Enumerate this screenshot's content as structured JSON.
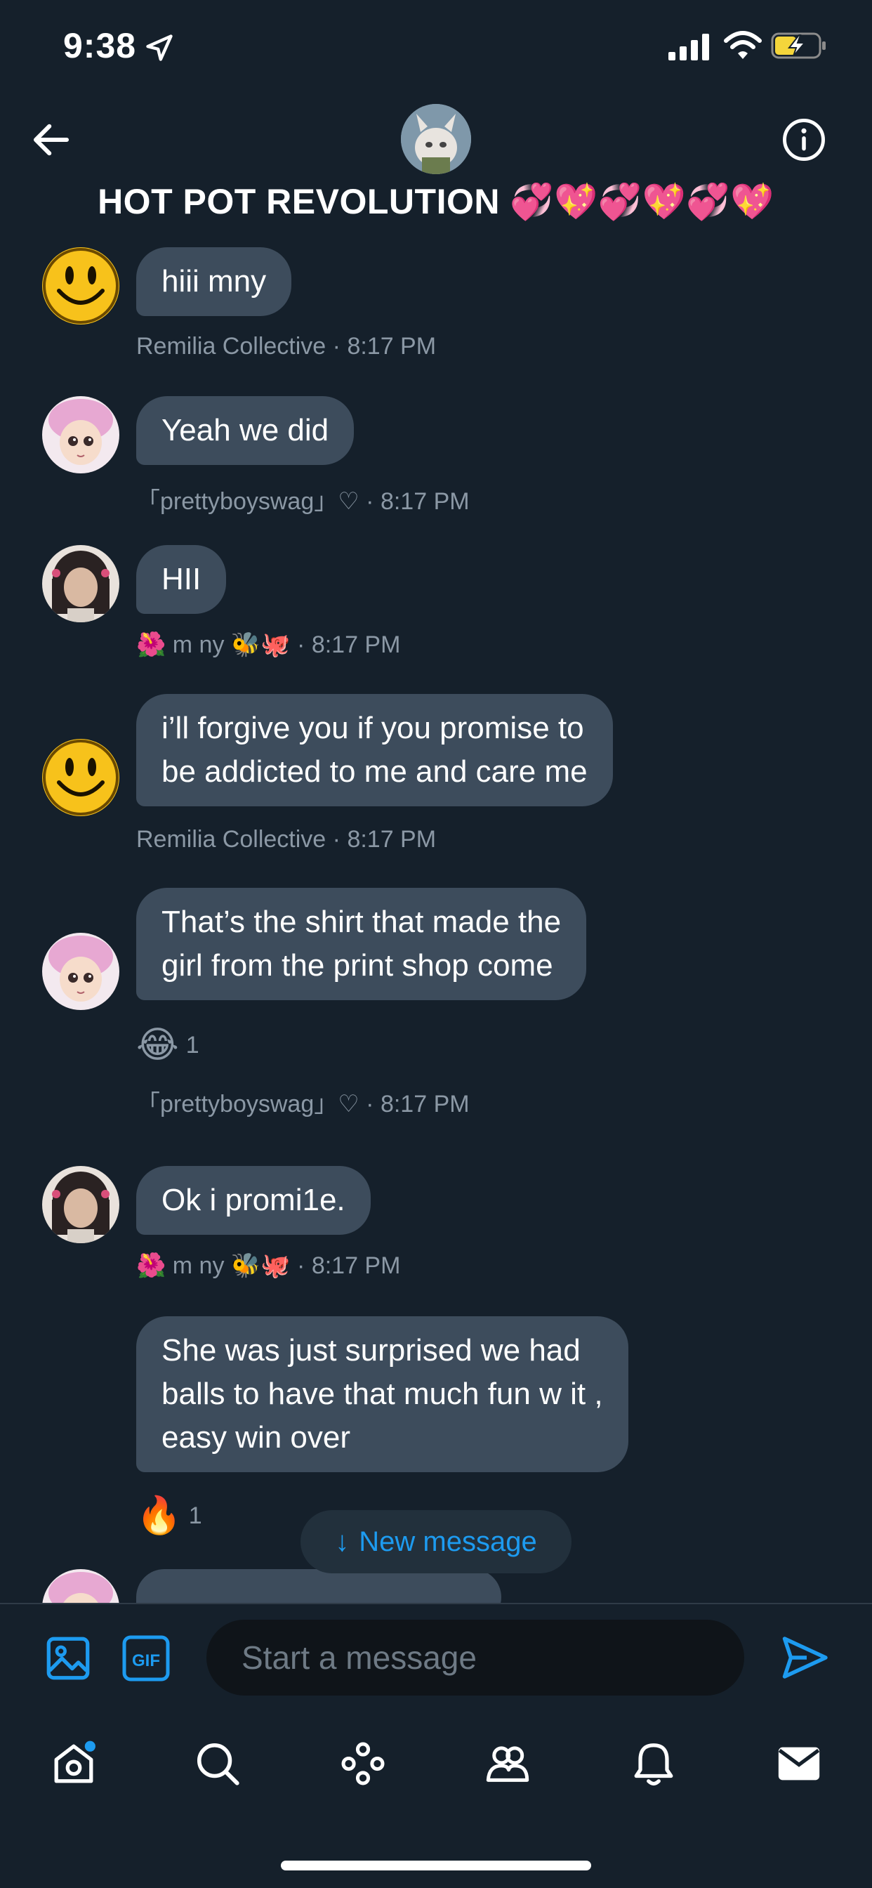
{
  "status_bar": {
    "time": "9:38"
  },
  "header": {
    "title": "HOT POT REVOLUTION",
    "title_emojis": "💞💖💞💖💞💖",
    "back_icon": "arrow-left-icon",
    "info_icon": "info-circle-icon"
  },
  "messages": [
    {
      "text": "hiii mny",
      "sender": "Remilia Collective",
      "time": "8:17 PM",
      "avatar": "smiley"
    },
    {
      "text": "Yeah we did",
      "sender": "「prettyboyswag」♡",
      "time": "8:17 PM",
      "avatar": "pink-hair"
    },
    {
      "text": "HII",
      "sender": "🌺 m ny 🐝🐙",
      "time": "8:17 PM",
      "avatar": "dark-hair"
    },
    {
      "line1": "i’ll forgive you if you promise to",
      "line2": "be addicted to me and care me",
      "sender": "Remilia Collective",
      "time": "8:17 PM",
      "avatar": "smiley"
    },
    {
      "line1": "That’s the shirt that made the",
      "line2": "girl from the print shop come",
      "reaction_emoji": "😂",
      "reaction_count": "1",
      "sender": "「prettyboyswag」♡",
      "time": "8:17 PM",
      "avatar": "pink-hair"
    },
    {
      "text": "Ok i promi1e.",
      "sender": "🌺 m ny 🐝🐙",
      "time": "8:17 PM",
      "avatar": "dark-hair"
    },
    {
      "line1": "She was just surprised we had",
      "line2": "balls to have that much fun w it ,",
      "line3": "easy win over",
      "reaction_emoji": "🔥",
      "reaction_count": "1"
    }
  ],
  "meta_separator": "·",
  "new_message": {
    "label": "New message",
    "arrow": "↓"
  },
  "composer": {
    "placeholder": "Start a message",
    "gif_label": "GIF"
  },
  "tabs": [
    "home-icon",
    "search-icon",
    "spaces-icon",
    "communities-icon",
    "notifications-icon",
    "messages-icon"
  ],
  "colors": {
    "background": "#15202b",
    "bubble": "#3d4c5c",
    "accent": "#1d9bf0",
    "meta": "#8b98a5"
  }
}
